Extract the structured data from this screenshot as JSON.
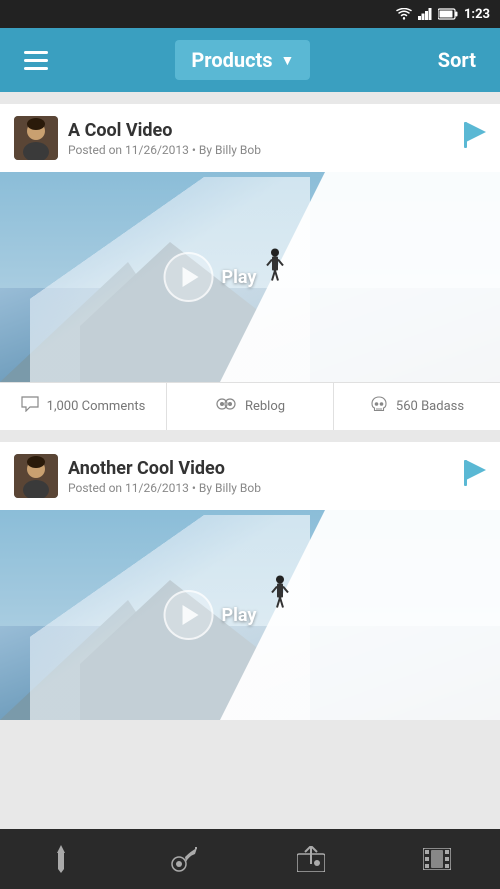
{
  "status": {
    "time": "1:23",
    "wifi": "📶",
    "signal": "📡",
    "battery": "🔋"
  },
  "navbar": {
    "products_label": "Products",
    "dropdown_arrow": "▼",
    "sort_label": "Sort"
  },
  "posts": [
    {
      "id": 1,
      "title": "A Cool Video",
      "meta": "Posted on 11/26/2013 • By Billy Bob",
      "play_label": "Play",
      "actions": [
        {
          "icon": "comment",
          "label": "1,000 Comments"
        },
        {
          "icon": "reblog",
          "label": "Reblog"
        },
        {
          "icon": "skull",
          "label": "560 Badass"
        }
      ]
    },
    {
      "id": 2,
      "title": "Another Cool Video",
      "meta": "Posted on 11/26/2013 • By Billy Bob",
      "play_label": "Play",
      "actions": []
    }
  ],
  "bottom_nav": [
    {
      "icon": "pen",
      "label": "write",
      "active": false
    },
    {
      "icon": "gramophone",
      "label": "audio",
      "active": false
    },
    {
      "icon": "photo",
      "label": "photos",
      "active": false
    },
    {
      "icon": "film",
      "label": "video",
      "active": false
    }
  ]
}
